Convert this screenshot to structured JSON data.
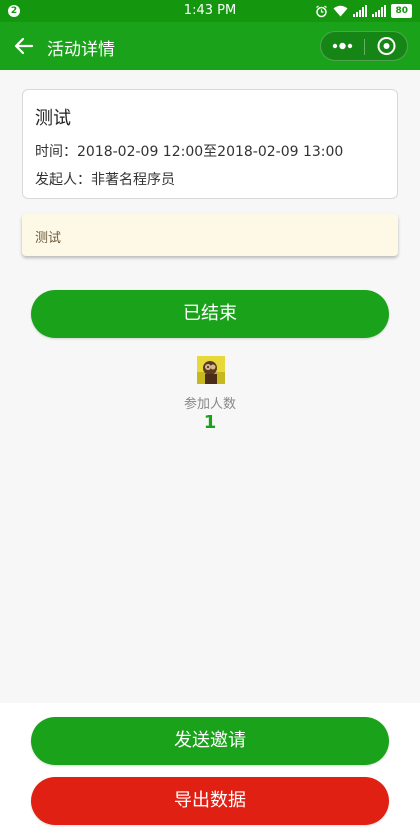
{
  "status_bar": {
    "notification_count": "2",
    "time": "1:43 PM",
    "battery": "80",
    "icons": [
      "alarm-icon",
      "wifi-icon",
      "signal-icon",
      "signal-icon",
      "battery-icon"
    ]
  },
  "navbar": {
    "title": "活动详情",
    "back_icon": "arrow-left-icon",
    "more_icon": "more-dots-icon",
    "close_icon": "record-circle-icon"
  },
  "event": {
    "title": "测试",
    "time_label": "时间：",
    "time_value": "2018-02-09 12:00至2018-02-09 13:00",
    "organizer_label": "发起人：",
    "organizer_value": "非著名程序员",
    "note": "测试"
  },
  "status_button": {
    "label": "已结束"
  },
  "participants": {
    "label": "参加人数",
    "count": "1"
  },
  "actions": {
    "invite_label": "发送邀请",
    "export_label": "导出数据"
  },
  "colors": {
    "primary_green": "#1aa31a",
    "status_bar_green": "#14960f",
    "danger_red": "#e02012",
    "note_bg": "#fdf9e6",
    "page_bg": "#f7f7f7"
  }
}
